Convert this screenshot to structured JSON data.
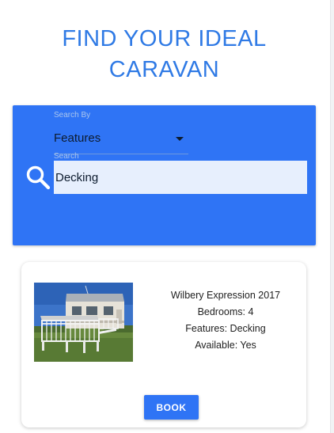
{
  "page": {
    "title": "FIND YOUR IDEAL\nCARAVAN"
  },
  "search": {
    "search_by_label": "Search By",
    "search_by_value": "Features",
    "search_label": "Search",
    "search_value": "Decking",
    "search_icon": "magnifier-icon"
  },
  "results": [
    {
      "name": "Wilbery Expression 2017",
      "bedrooms": "Bedrooms: 4",
      "features": "Features: Decking",
      "available": "Available: Yes",
      "book_label": "BOOK"
    }
  ],
  "colors": {
    "accent": "#2f74f5",
    "title": "#2f7ae5",
    "input_bg": "#e7effd"
  }
}
